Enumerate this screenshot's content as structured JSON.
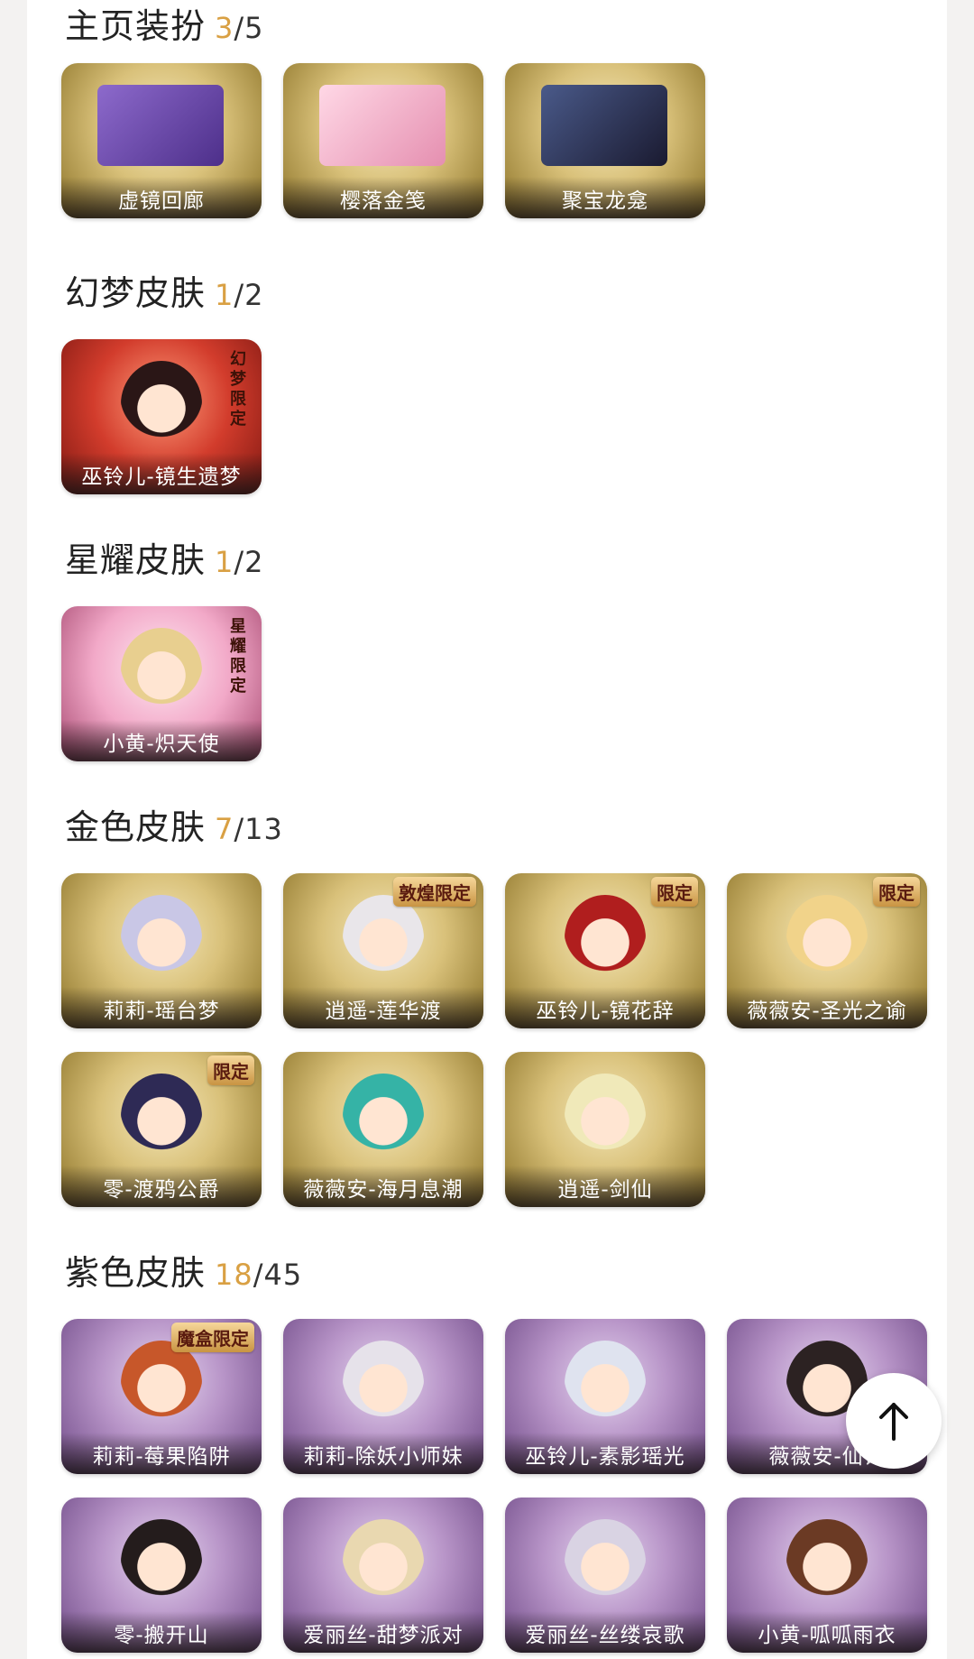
{
  "sections": [
    {
      "title": "主页装扮",
      "owned": "3",
      "total": "5",
      "items": [
        {
          "label": "虚镜回廊",
          "theme": "gold",
          "thumb": "#7a58b8"
        },
        {
          "label": "樱落金笺",
          "theme": "gold",
          "thumb": "#f0b6c9"
        },
        {
          "label": "聚宝龙龛",
          "theme": "gold",
          "thumb": "#2d3350"
        }
      ]
    },
    {
      "title": "幻梦皮肤",
      "owned": "1",
      "total": "2",
      "items": [
        {
          "label": "巫铃儿-镜生遗梦",
          "theme": "red",
          "hair": "#2a1616",
          "vbadge": "幻梦限定"
        }
      ]
    },
    {
      "title": "星耀皮肤",
      "owned": "1",
      "total": "2",
      "items": [
        {
          "label": "小黄-炽天使",
          "theme": "pink",
          "hair": "#e8cf8f",
          "vbadge": "星耀限定"
        }
      ]
    },
    {
      "title": "金色皮肤",
      "owned": "7",
      "total": "13",
      "items": [
        {
          "label": "莉莉-瑶台梦",
          "theme": "gold",
          "hair": "#c9c7e6"
        },
        {
          "label": "逍遥-莲华渡",
          "theme": "gold",
          "hair": "#e9e6ea",
          "badge": "敦煌限定"
        },
        {
          "label": "巫铃儿-镜花辞",
          "theme": "gold",
          "hair": "#b01e1e",
          "badge": "限定"
        },
        {
          "label": "薇薇安-圣光之谕",
          "theme": "gold",
          "hair": "#f1d38a",
          "badge": "限定"
        },
        {
          "label": "零-渡鸦公爵",
          "theme": "gold",
          "hair": "#2e2a55",
          "badge": "限定"
        },
        {
          "label": "薇薇安-海月息潮",
          "theme": "gold",
          "hair": "#35b3a6"
        },
        {
          "label": "逍遥-剑仙",
          "theme": "gold",
          "hair": "#f0e9b9"
        }
      ]
    },
    {
      "title": "紫色皮肤",
      "owned": "18",
      "total": "45",
      "items": [
        {
          "label": "莉莉-莓果陷阱",
          "theme": "purple",
          "hair": "#c7572a",
          "badge": "魔盒限定"
        },
        {
          "label": "莉莉-除妖小师妹",
          "theme": "purple",
          "hair": "#e6e2ea"
        },
        {
          "label": "巫铃儿-素影瑶光",
          "theme": "purple",
          "hair": "#dfe3ef"
        },
        {
          "label": "薇薇安-仙锋",
          "theme": "purple",
          "hair": "#2c2222"
        },
        {
          "label": "零-搬开山",
          "theme": "purple",
          "hair": "#241c1c"
        },
        {
          "label": "爱丽丝-甜梦派对",
          "theme": "purple",
          "hair": "#e9d8b0"
        },
        {
          "label": "爱丽丝-丝缕哀歌",
          "theme": "purple",
          "hair": "#d9d3e3"
        },
        {
          "label": "小黄-呱呱雨衣",
          "theme": "purple",
          "hair": "#6b3a24"
        }
      ]
    }
  ],
  "scroll_top": {
    "icon": "arrow-up-icon"
  }
}
